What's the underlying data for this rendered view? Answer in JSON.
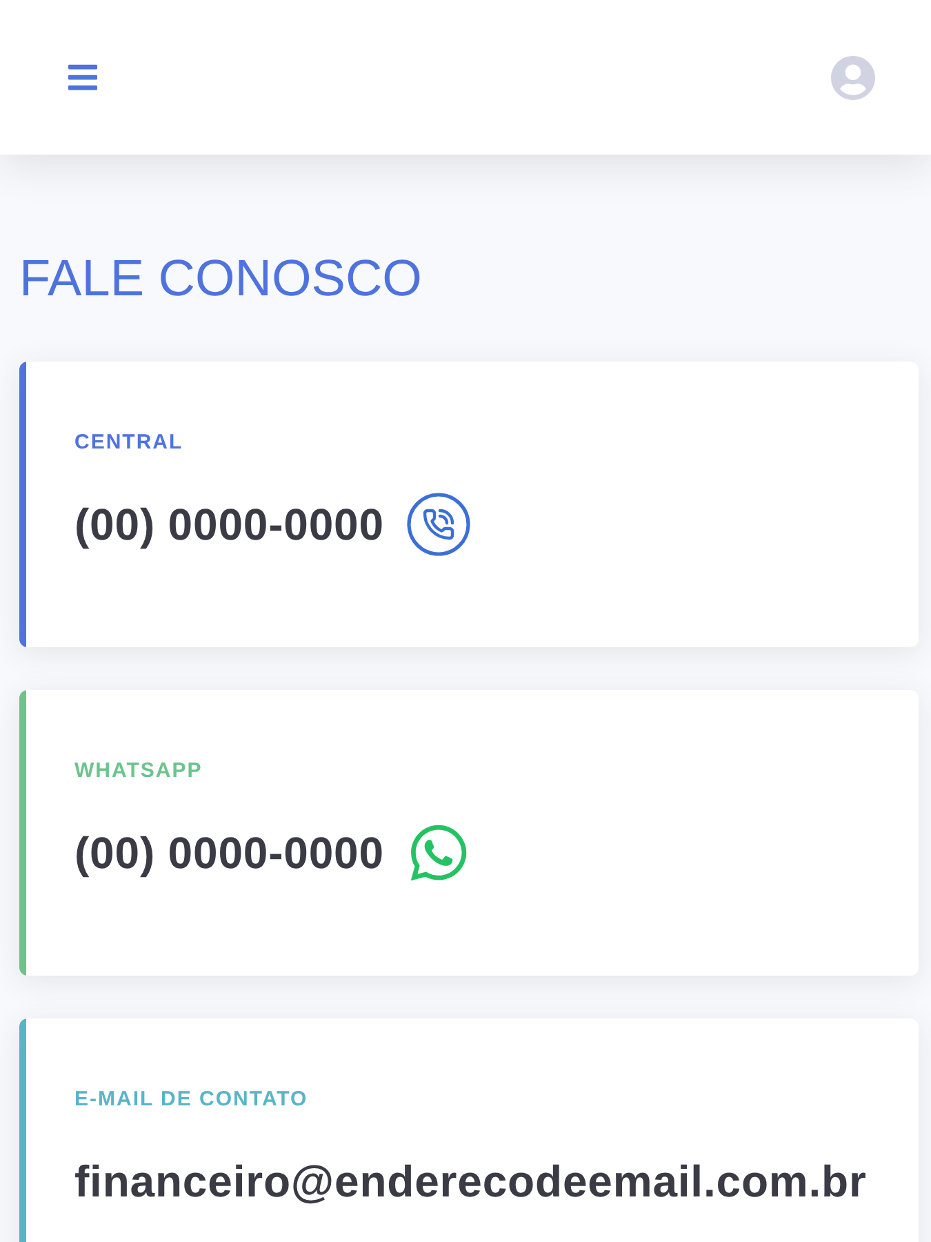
{
  "page_title": "FALE CONOSCO",
  "contacts": [
    {
      "label": "CENTRAL",
      "value": "(00) 0000-0000",
      "kind": "phone",
      "color": "#4e73df"
    },
    {
      "label": "WHATSAPP",
      "value": "(00) 0000-0000",
      "kind": "whatsapp",
      "color": "#6cc48c"
    },
    {
      "label": "E-MAIL DE CONTATO",
      "value": "financeiro@enderecodeemail.com.br",
      "kind": "email",
      "color": "#5ab4c8"
    }
  ]
}
